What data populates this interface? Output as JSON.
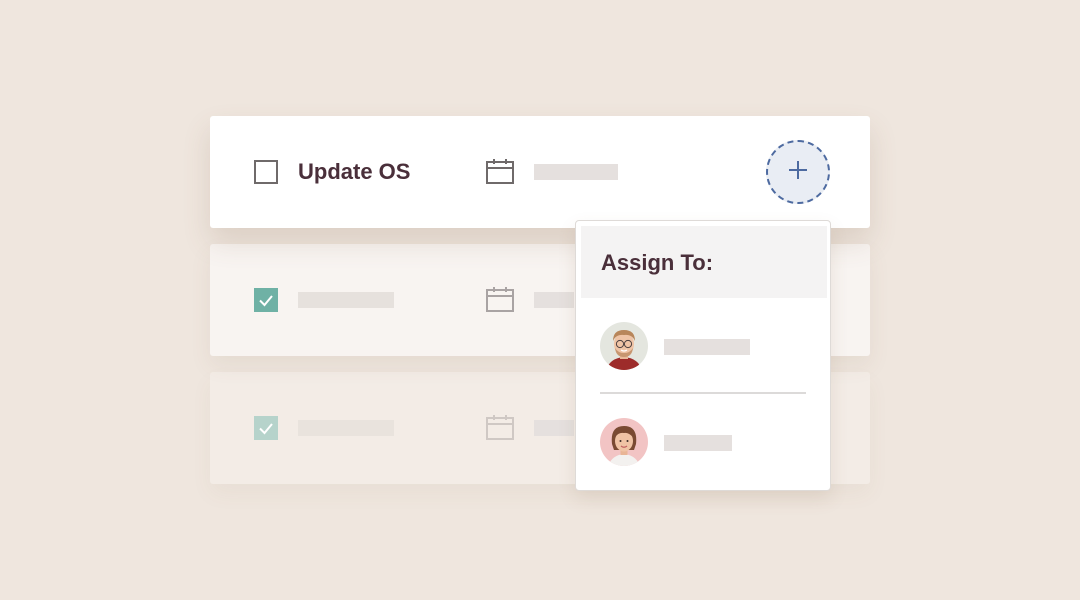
{
  "tasks": [
    {
      "title": "Update OS",
      "completed": false,
      "active": true
    },
    {
      "title": "",
      "completed": true,
      "active": false
    },
    {
      "title": "",
      "completed": true,
      "active": false
    }
  ],
  "icons": {
    "checkbox": "checkbox-icon",
    "check": "checkmark-icon",
    "calendar": "calendar-icon",
    "add": "plus-icon"
  },
  "assign_menu": {
    "title": "Assign To:",
    "assignees": [
      {
        "avatar": "man-with-glasses-avatar"
      },
      {
        "avatar": "woman-avatar"
      }
    ]
  },
  "colors": {
    "background": "#efe6de",
    "accent_teal": "#6fb1a5",
    "add_button_border": "#4d6aa0",
    "title_text": "#4a2f3a"
  }
}
